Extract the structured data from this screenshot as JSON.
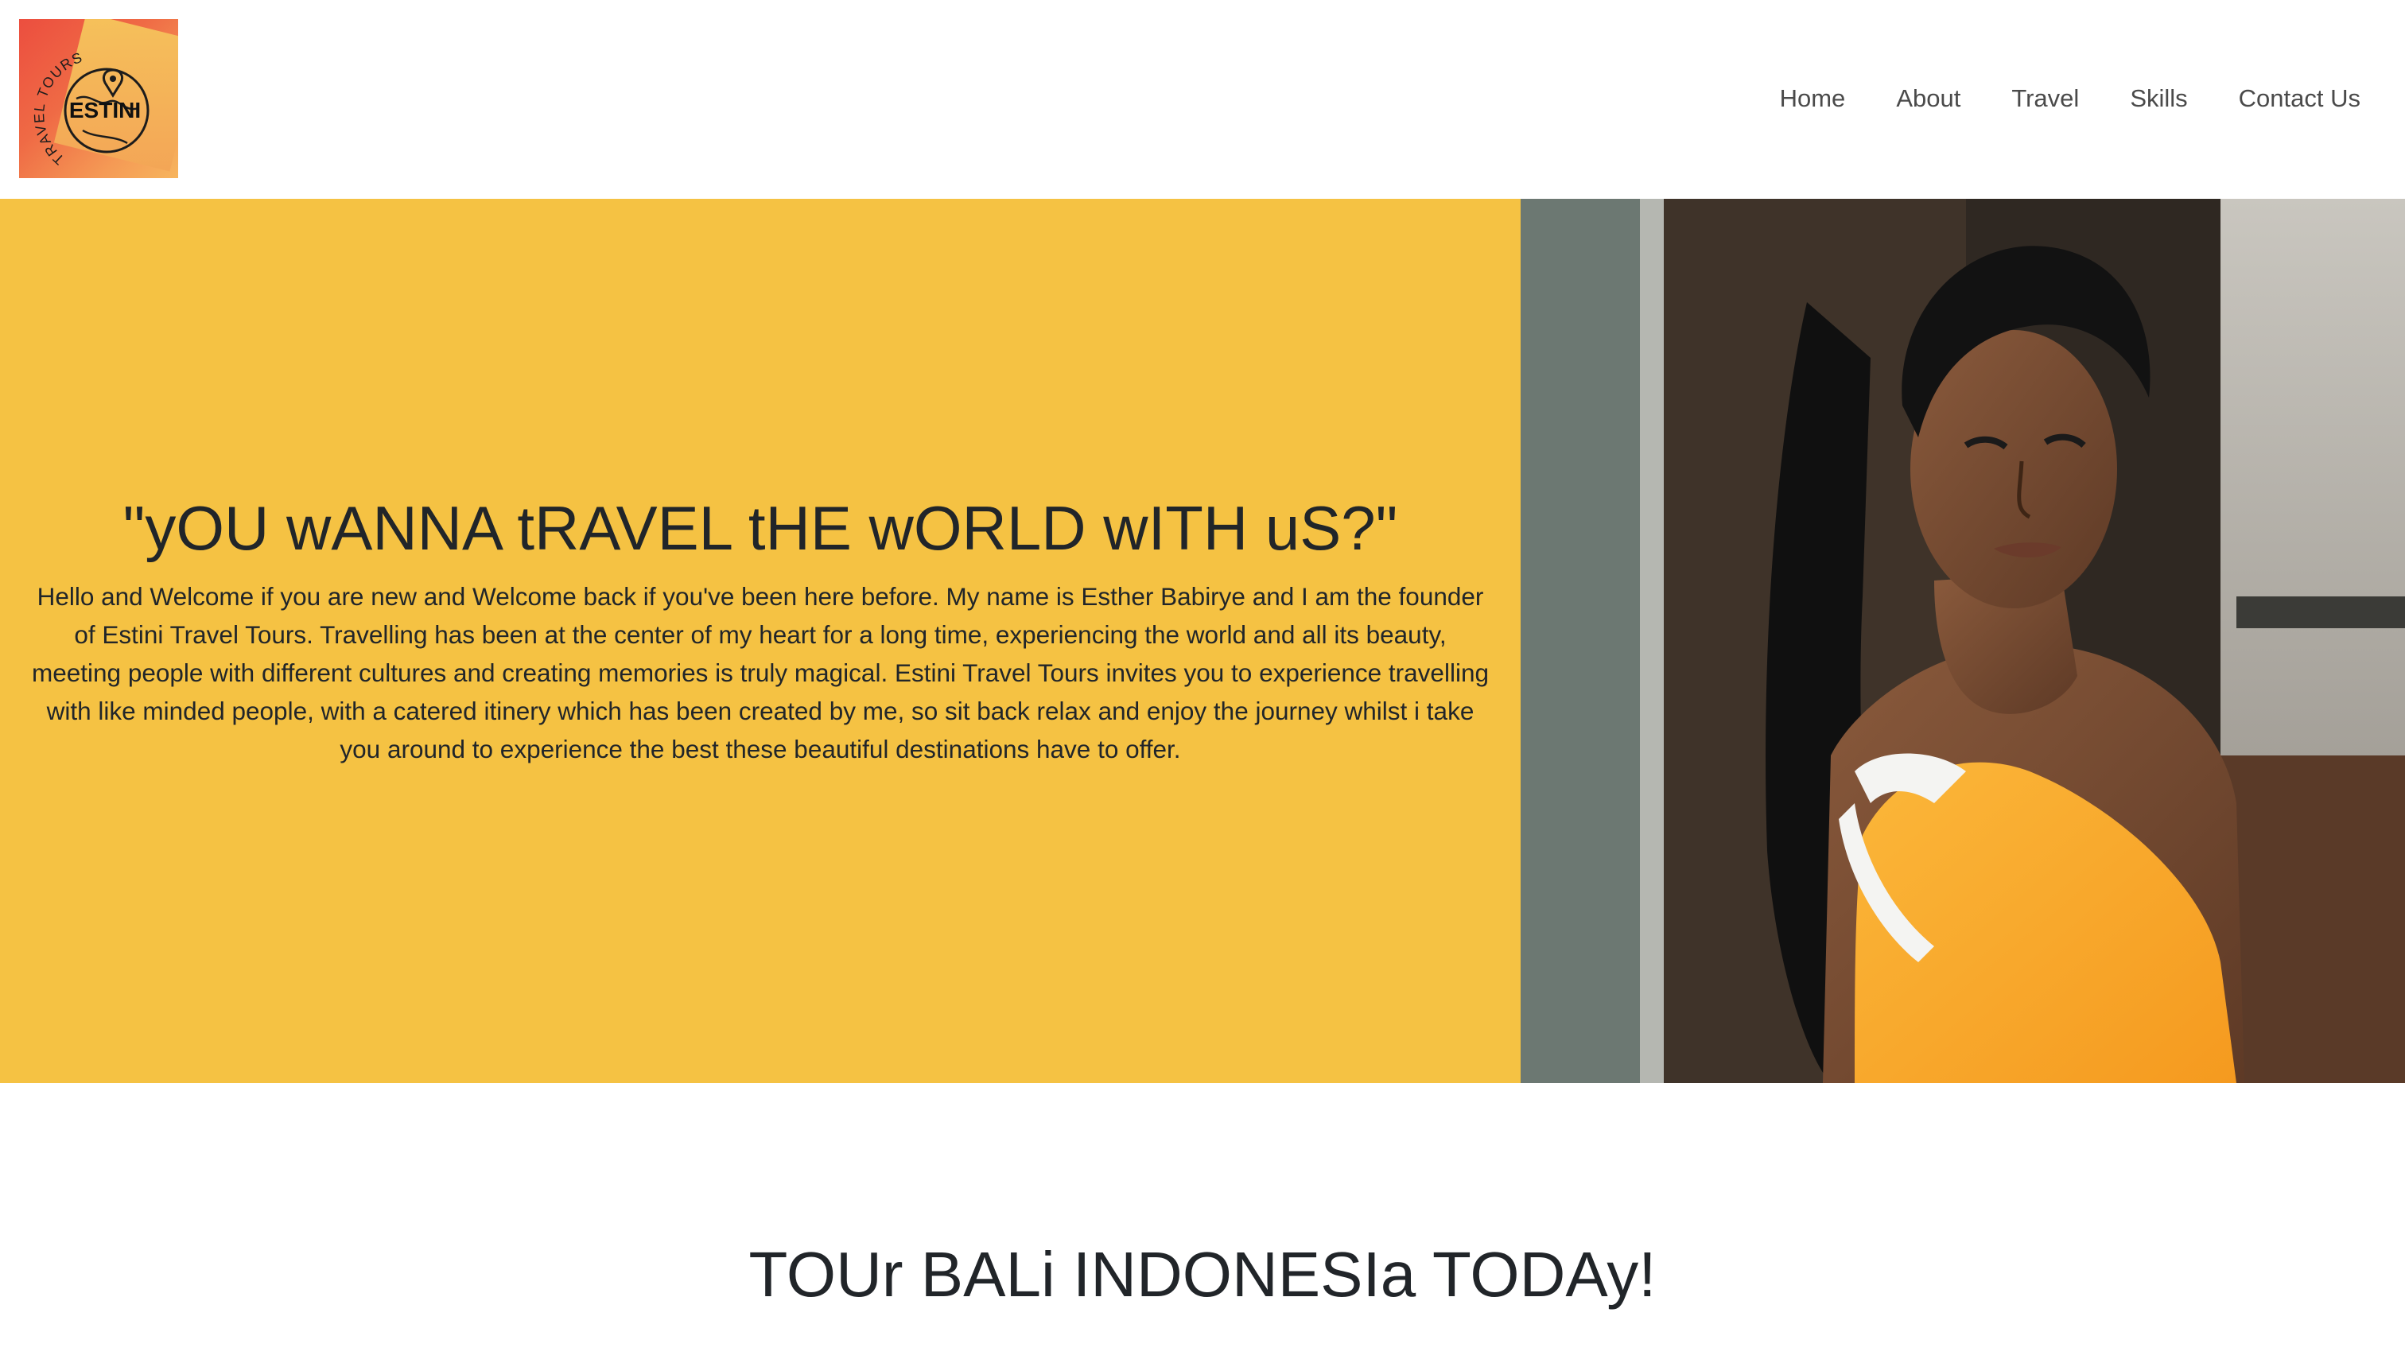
{
  "brand": {
    "logo_ring_text": "TRAVEL TOURS",
    "logo_name": "ESTINI",
    "logo_colors": {
      "red": "#ec4e3f",
      "orange": "#f59a55",
      "yellow": "#f6c75c"
    }
  },
  "nav": {
    "items": [
      {
        "label": "Home"
      },
      {
        "label": "About"
      },
      {
        "label": "Travel"
      },
      {
        "label": "Skills"
      },
      {
        "label": "Contact Us"
      }
    ]
  },
  "hero": {
    "heading": "\"yOU wANNA tRAVEL tHE wORLD wITH uS?\"",
    "paragraph": "Hello and Welcome if you are new and Welcome back if you've been here before. My name is Esther Babirye and I am the founder of Estini Travel Tours. Travelling has been at the center of my heart for a long time, experiencing the world and all its beauty, meeting people with different cultures and creating memories is truly magical. Estini Travel Tours invites you to experience travelling with like minded people, with a catered itinery which has been created by me, so sit back relax and enjoy the journey whilst i take you around to experience the best these beautiful destinations have to offer.",
    "background_color": "#f5c243",
    "photo_icon": "portrait-photo"
  },
  "section": {
    "title": "TOUr BALi INDONESIa TODAy!"
  }
}
